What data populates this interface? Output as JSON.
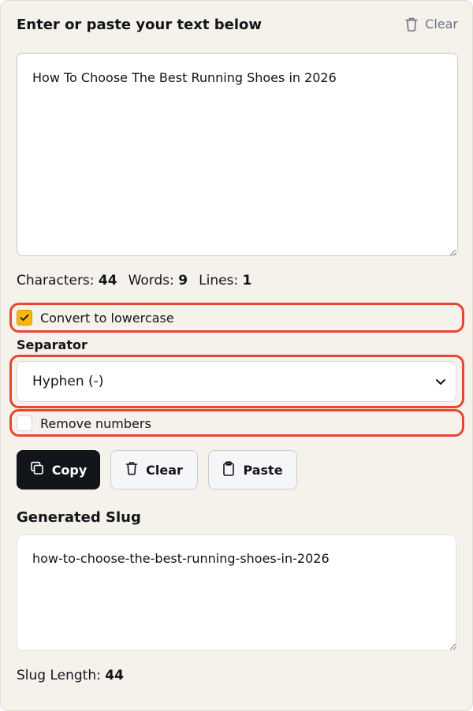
{
  "header": {
    "title": "Enter or paste your text below",
    "clear_label": "Clear"
  },
  "input": {
    "value": "How To Choose The Best Running Shoes in 2026"
  },
  "stats": {
    "characters_label": "Characters:",
    "characters_value": "44",
    "words_label": "Words:",
    "words_value": "9",
    "lines_label": "Lines:",
    "lines_value": "1"
  },
  "options": {
    "lowercase_label": "Convert to lowercase",
    "lowercase_checked": true,
    "separator_label": "Separator",
    "separator_selected": "Hyphen (-)",
    "remove_numbers_label": "Remove numbers",
    "remove_numbers_checked": false
  },
  "buttons": {
    "copy_label": "Copy",
    "clear_label": "Clear",
    "paste_label": "Paste"
  },
  "output": {
    "title": "Generated Slug",
    "slug": "how-to-choose-the-best-running-shoes-in-2026",
    "length_label": "Slug Length:",
    "length_value": "44"
  },
  "colors": {
    "panel_bg": "#f5f2ec",
    "accent_checkbox": "#f5b80a",
    "highlight_border": "#e5472f",
    "primary_button": "#111418"
  },
  "icons": {
    "header_clear": "trash-icon",
    "copy": "copy-icon",
    "clear": "trash-icon",
    "paste": "clipboard-icon",
    "select": "chevron-down-icon",
    "check": "check-icon"
  }
}
